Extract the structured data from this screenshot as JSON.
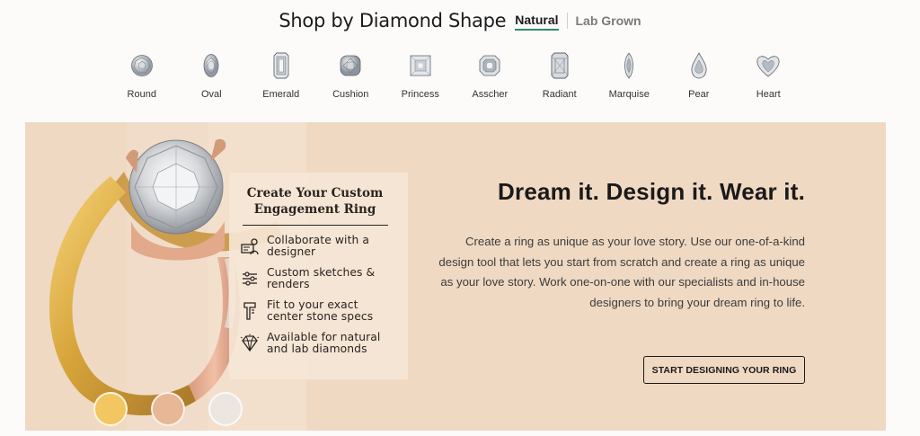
{
  "header": {
    "title": "Shop by Diamond Shape",
    "tabs": [
      {
        "label": "Natural",
        "active": true
      },
      {
        "label": "Lab Grown",
        "active": false
      }
    ]
  },
  "shapes": [
    {
      "label": "Round",
      "icon": "round-diamond-icon"
    },
    {
      "label": "Oval",
      "icon": "oval-diamond-icon"
    },
    {
      "label": "Emerald",
      "icon": "emerald-diamond-icon"
    },
    {
      "label": "Cushion",
      "icon": "cushion-diamond-icon"
    },
    {
      "label": "Princess",
      "icon": "princess-diamond-icon"
    },
    {
      "label": "Asscher",
      "icon": "asscher-diamond-icon"
    },
    {
      "label": "Radiant",
      "icon": "radiant-diamond-icon"
    },
    {
      "label": "Marquise",
      "icon": "marquise-diamond-icon"
    },
    {
      "label": "Pear",
      "icon": "pear-diamond-icon"
    },
    {
      "label": "Heart",
      "icon": "heart-diamond-icon"
    }
  ],
  "banner": {
    "card": {
      "title_line1": "Create Your Custom",
      "title_line2": "Engagement Ring",
      "features": [
        {
          "line1": "Collaborate with a",
          "line2": "designer",
          "icon": "designer-icon"
        },
        {
          "line1": "Custom sketches &",
          "line2": "renders",
          "icon": "sliders-icon"
        },
        {
          "line1": "Fit to your exact",
          "line2": "center stone specs",
          "icon": "caliper-icon"
        },
        {
          "line1": "Available for natural",
          "line2": "and lab diamonds",
          "icon": "diamond-icon"
        }
      ]
    },
    "headline": "Dream it. Design it. Wear it.",
    "description": "Create a ring as unique as your love story. Use our one-of-a-kind design tool that lets you start from scratch and create a ring as unique as your love story. Work one-on-one with our specialists and in-house designers to bring your dream ring to life.",
    "cta_label": "START DESIGNING YOUR RING",
    "swatches": [
      {
        "name": "yellow-gold",
        "color": "#f2c660"
      },
      {
        "name": "rose-gold",
        "color": "#e8b795"
      },
      {
        "name": "white-gold",
        "color": "#ece6e0"
      }
    ]
  },
  "colors": {
    "banner_bg": "#efd9c2",
    "active_tab_underline": "#2e8a6b"
  }
}
